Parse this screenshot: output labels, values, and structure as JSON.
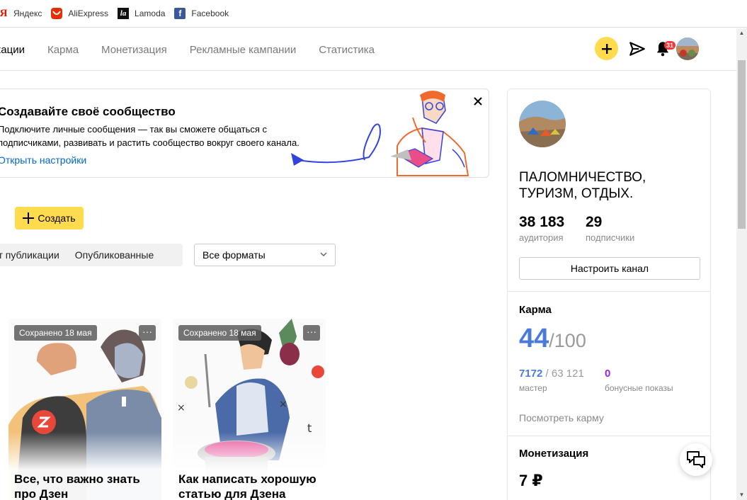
{
  "bookmarks": [
    {
      "label": "Яндекс",
      "icon": "yandex-icon",
      "glyph": "Я"
    },
    {
      "label": "AliExpress",
      "icon": "aliexpress-icon",
      "glyph": "A"
    },
    {
      "label": "Lamoda",
      "icon": "lamoda-icon",
      "glyph": "la"
    },
    {
      "label": "Facebook",
      "icon": "facebook-icon",
      "glyph": "f"
    }
  ],
  "nav": {
    "tabs": [
      "икации",
      "Карма",
      "Монетизация",
      "Рекламные кампании",
      "Статистика"
    ],
    "active_index": 0,
    "notifications_count": "31"
  },
  "promo": {
    "title": "Создавайте своё сообщество",
    "text": "Подключите личные сообщения — так вы сможете общаться с подписчиками, развивать и растить сообщество вокруг своего канала.",
    "link": "Открыть настройки",
    "close": "×"
  },
  "publications": {
    "title_stub": "I",
    "create_label": "Создать",
    "filters": [
      "от публикации",
      "Опубликованные"
    ],
    "format_select": "Все форматы"
  },
  "cards": [
    {
      "badge": "Сохранено 18 мая",
      "title": "Все, что важно знать про Дзен",
      "more": "···"
    },
    {
      "badge": "Сохранено 18 мая",
      "title": "Как написать хорошую статью для Дзена",
      "more": "···"
    }
  ],
  "channel": {
    "name": "ПАЛОМНИЧЕСТВО, ТУРИЗМ, ОТДЫХ.",
    "audience_value": "38 183",
    "audience_label": "аудитория",
    "subscribers_value": "29",
    "subscribers_label": "подписчики",
    "setup_label": "Настроить канал"
  },
  "karma": {
    "title": "Карма",
    "value": "44",
    "max": "/100",
    "points": "7172",
    "points_total": " / 63 121",
    "level_label": "мастер",
    "bonus_value": "0",
    "bonus_label": "бонусные показы",
    "link": "Посмотреть карму"
  },
  "monetization": {
    "title": "Монетизация",
    "value": "7 ₽"
  },
  "colors": {
    "accent_yellow": "#ffdb4d",
    "link_blue": "#0066cc",
    "karma_blue": "#4a7bdb",
    "bonus_purple": "#a020f0",
    "badge_red": "#ff3333"
  }
}
